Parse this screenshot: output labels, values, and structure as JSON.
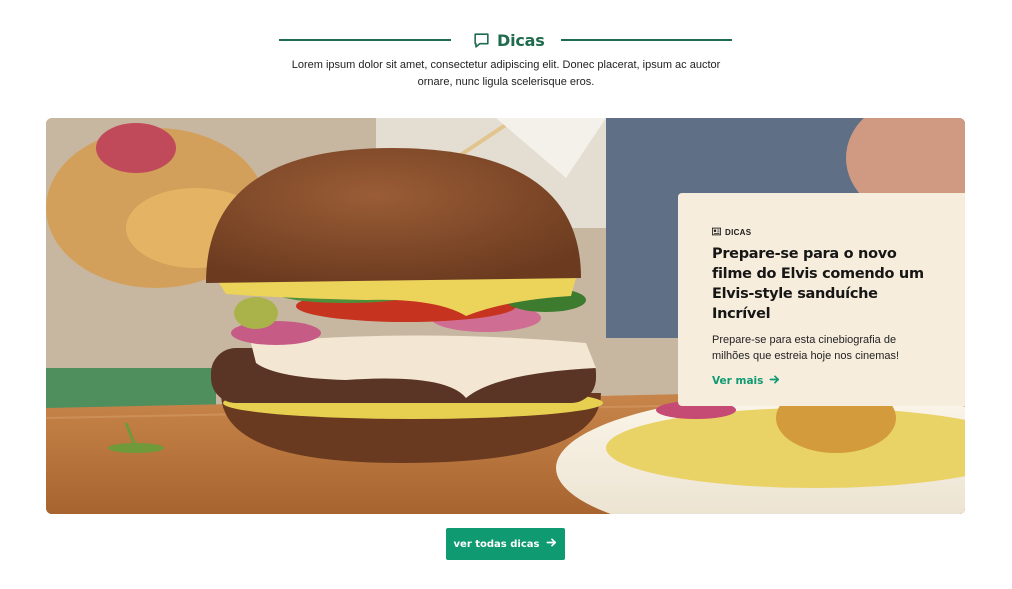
{
  "section": {
    "title": "Dicas",
    "description": "Lorem ipsum dolor sit amet, consectetur adipiscing elit. Donec placerat, ipsum ac auctor ornare, nunc ligula scelerisque eros.",
    "icon": "chat-bubble-icon",
    "accent_color": "#1f6b4e"
  },
  "hero": {
    "image": "burger-photo",
    "card": {
      "tag": "DICAS",
      "tag_icon": "tips-icon",
      "title": "Prepare-se para o novo filme do Elvis comendo um Elvis-style sanduíche Incrível",
      "text": "Prepare-se para esta cinebiografia de milhões que estreia hoje nos cinemas!",
      "link_label": "Ver mais",
      "link_icon": "arrow-right-icon",
      "background": "#f7eddd"
    }
  },
  "cta": {
    "label": "ver todas dicas",
    "icon": "arrow-right-icon",
    "color": "#0f9a72"
  }
}
